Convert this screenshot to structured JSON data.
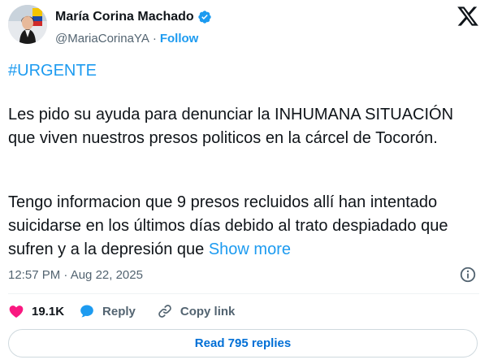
{
  "author": {
    "display_name": "María Corina Machado",
    "handle": "@MariaCorinaYA",
    "separator": "·",
    "follow_label": "Follow",
    "verified_icon": "verified-badge-icon"
  },
  "tweet": {
    "hashtag": "#URGENTE",
    "paragraph_1": "Les pido su ayuda para denunciar la INHUMANA SITUACIÓN que viven nuestros presos politicos en la cárcel de Tocorón.",
    "paragraph_2": "Tengo informacion que 9 presos recluidos allí han intentado suicidarse en los últimos días debido al trato despiadado que sufren y a la depresión que",
    "show_more_label": "Show more",
    "timestamp": "12:57 PM · Aug 22, 2025"
  },
  "actions": {
    "likes_count": "19.1K",
    "reply_label": "Reply",
    "copy_link_label": "Copy link"
  },
  "read_replies_label": "Read 795 replies",
  "colors": {
    "accent": "#1d9bf0",
    "like": "#f91880",
    "muted": "#536471",
    "text": "#0f1419"
  }
}
